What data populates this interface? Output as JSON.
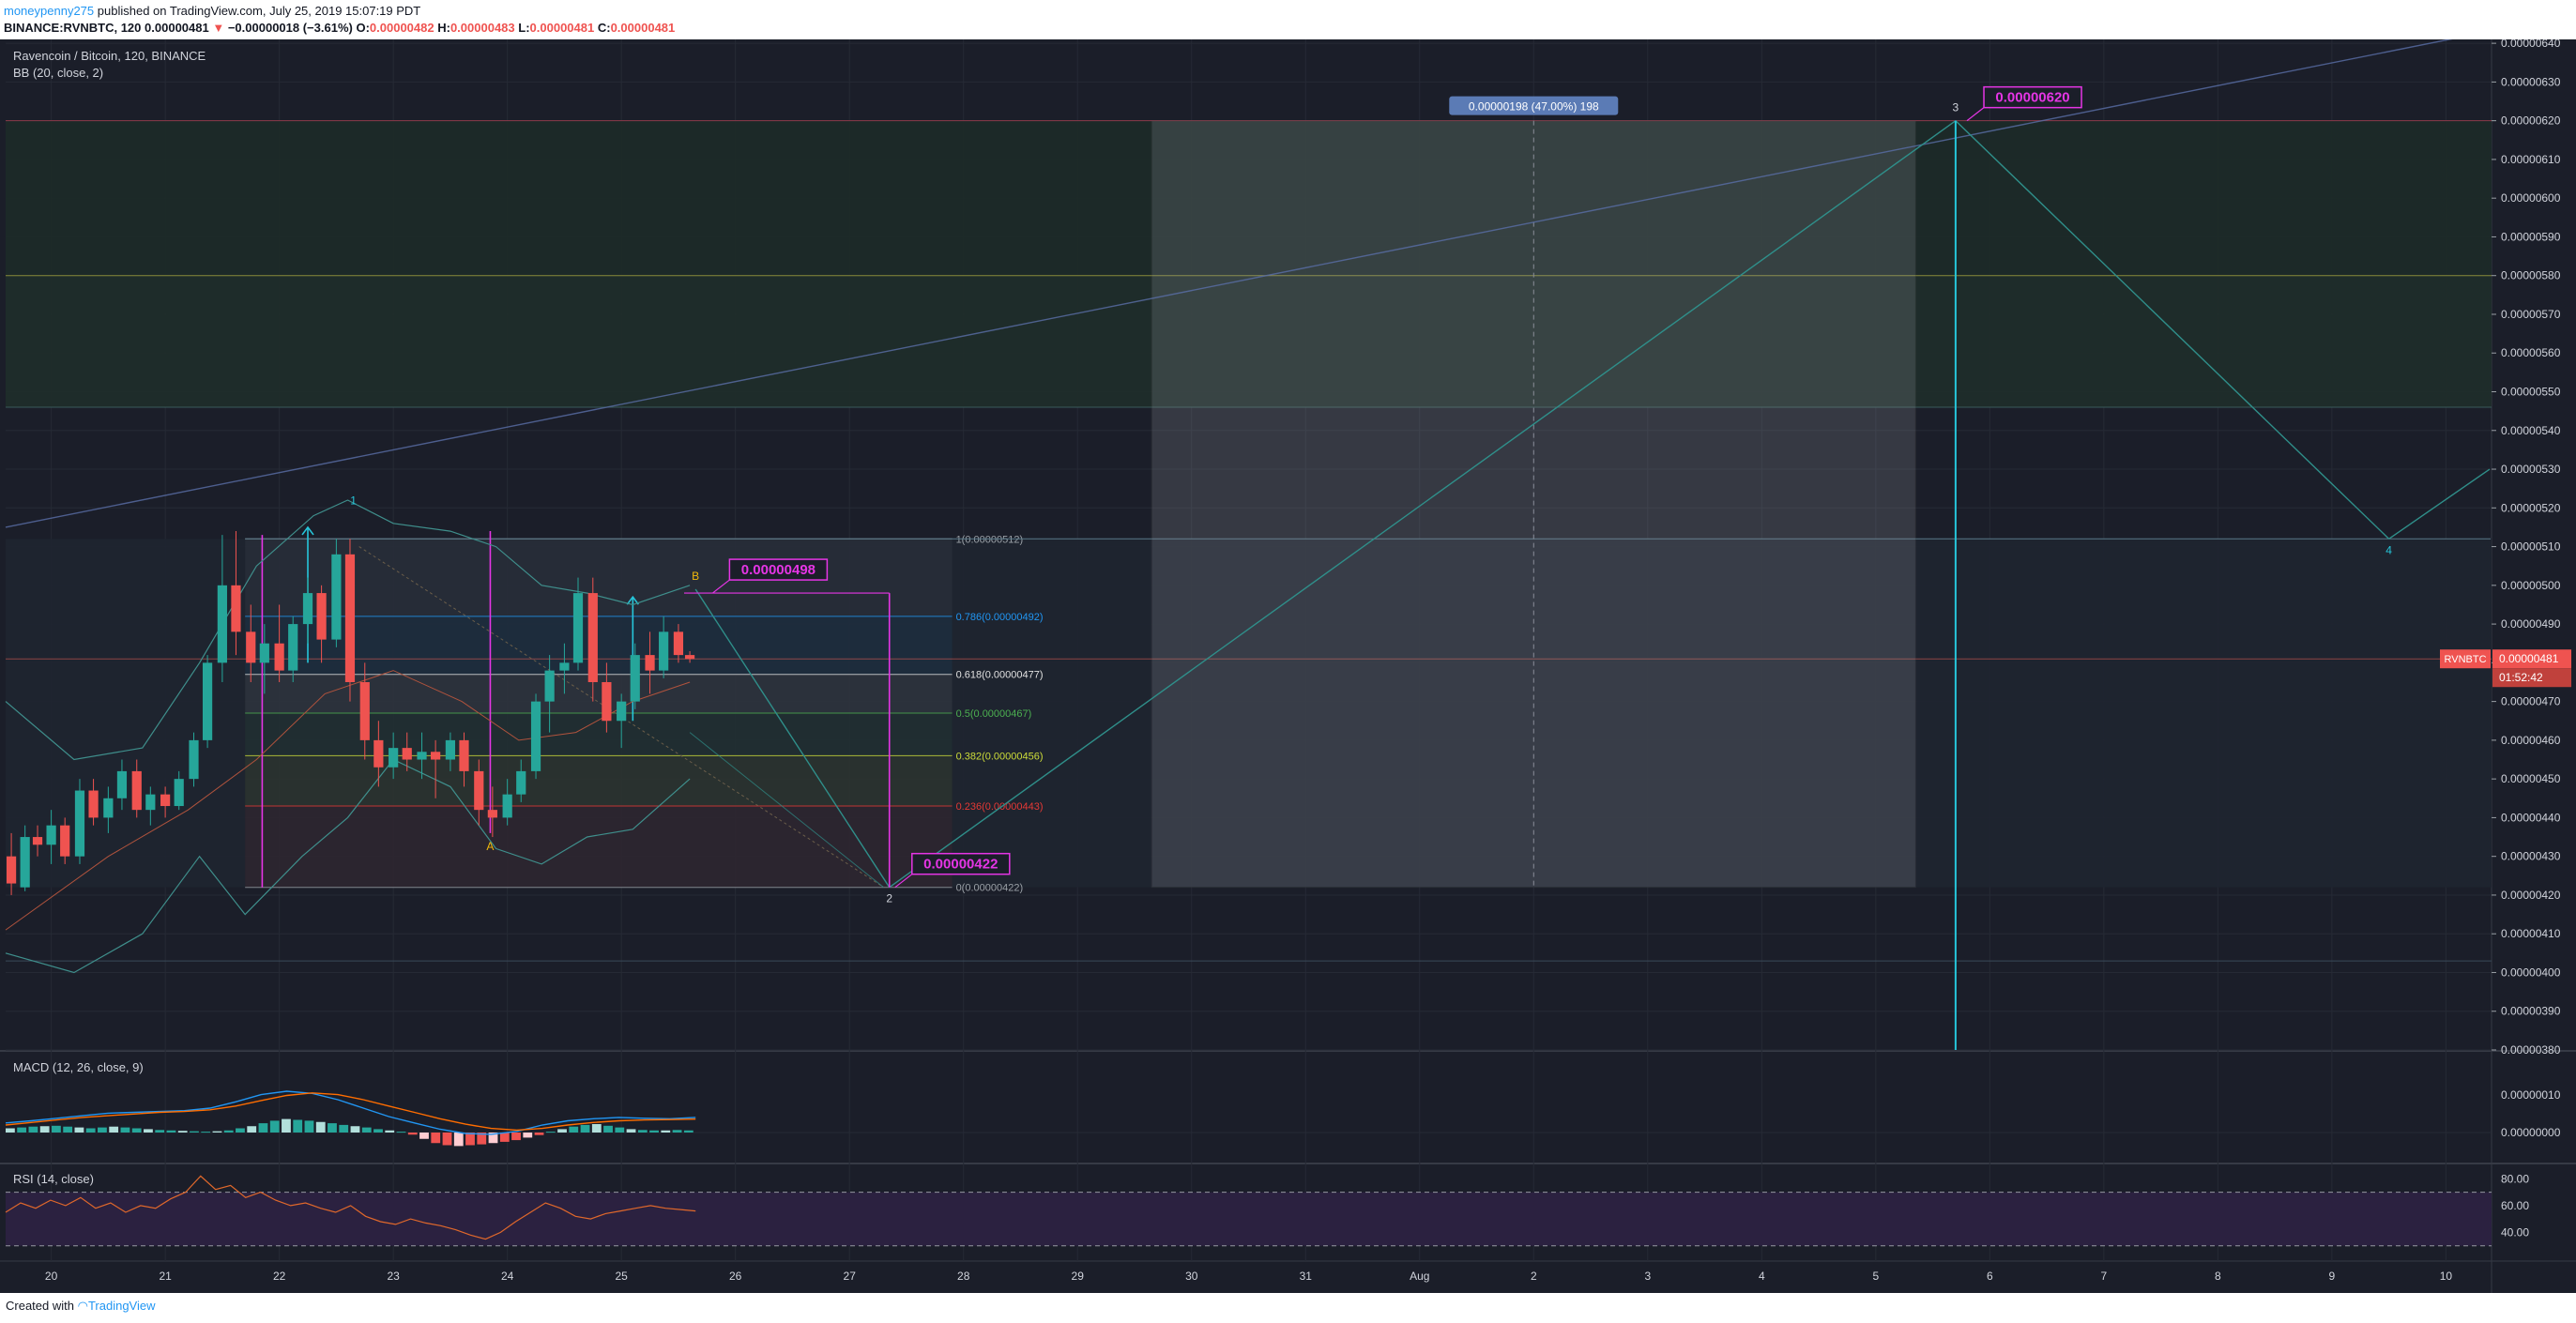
{
  "header": {
    "author": "moneypenny275",
    "published": "published on TradingView.com, July 25, 2019 15:07:19 PDT",
    "symbol_line": "BINANCE:RVNBTC, 120",
    "last": "0.00000481",
    "change_arrow": "▼",
    "change": "−0.00000018 (−3.61%)",
    "o_label": "O:",
    "o_value": "0.00000482",
    "h_label": "H:",
    "h_value": "0.00000483",
    "l_label": "L:",
    "l_value": "0.00000481",
    "c_label": "C:",
    "c_value": "0.00000481"
  },
  "footer": {
    "created_with": "Created with",
    "brand": "TradingView"
  },
  "colors": {
    "background": "#1b1e29",
    "up": "#26a69a",
    "down": "#ef5350",
    "bb": "#3f8f8c",
    "magenta": "#e535e5",
    "price_tag": "#ef5350"
  },
  "chart_data": [
    {
      "type": "line",
      "title": "Ravencoin / Bitcoin, 120, BINANCE",
      "indicator_label": "BB (20, close, 2)",
      "x_ticks": [
        "20",
        "21",
        "22",
        "23",
        "24",
        "25",
        "26",
        "27",
        "28",
        "29",
        "30",
        "31",
        "Aug",
        "2",
        "3",
        "4",
        "5",
        "6",
        "7",
        "8",
        "9",
        "10"
      ],
      "y_ticks": [
        "0.00000380",
        "0.00000390",
        "0.00000400",
        "0.00000410",
        "0.00000420",
        "0.00000430",
        "0.00000440",
        "0.00000450",
        "0.00000460",
        "0.00000470",
        "0.00000480",
        "0.00000490",
        "0.00000500",
        "0.00000510",
        "0.00000520",
        "0.00000530",
        "0.00000540",
        "0.00000550",
        "0.00000560",
        "0.00000570",
        "0.00000580",
        "0.00000590",
        "0.00000600",
        "0.00000610",
        "0.00000620",
        "0.00000630",
        "0.00000640"
      ],
      "ylim": [
        3.8e-06,
        6.41e-06
      ],
      "xlim": [
        19.6,
        41.4
      ],
      "candles": [
        {
          "t": 19.65,
          "o": 4.3,
          "h": 4.36,
          "l": 4.2,
          "c": 4.23
        },
        {
          "t": 19.77,
          "o": 4.22,
          "h": 4.38,
          "l": 4.21,
          "c": 4.35
        },
        {
          "t": 19.88,
          "o": 4.35,
          "h": 4.38,
          "l": 4.3,
          "c": 4.33
        },
        {
          "t": 20.0,
          "o": 4.33,
          "h": 4.42,
          "l": 4.28,
          "c": 4.38
        },
        {
          "t": 20.12,
          "o": 4.38,
          "h": 4.4,
          "l": 4.28,
          "c": 4.3
        },
        {
          "t": 20.25,
          "o": 4.3,
          "h": 4.5,
          "l": 4.28,
          "c": 4.47
        },
        {
          "t": 20.37,
          "o": 4.47,
          "h": 4.5,
          "l": 4.38,
          "c": 4.4
        },
        {
          "t": 20.5,
          "o": 4.4,
          "h": 4.48,
          "l": 4.36,
          "c": 4.45
        },
        {
          "t": 20.62,
          "o": 4.45,
          "h": 4.55,
          "l": 4.42,
          "c": 4.52
        },
        {
          "t": 20.75,
          "o": 4.52,
          "h": 4.55,
          "l": 4.4,
          "c": 4.42
        },
        {
          "t": 20.87,
          "o": 4.42,
          "h": 4.48,
          "l": 4.38,
          "c": 4.46
        },
        {
          "t": 21.0,
          "o": 4.46,
          "h": 4.48,
          "l": 4.4,
          "c": 4.43
        },
        {
          "t": 21.12,
          "o": 4.43,
          "h": 4.52,
          "l": 4.42,
          "c": 4.5
        },
        {
          "t": 21.25,
          "o": 4.5,
          "h": 4.62,
          "l": 4.48,
          "c": 4.6
        },
        {
          "t": 21.37,
          "o": 4.6,
          "h": 4.82,
          "l": 4.58,
          "c": 4.8
        },
        {
          "t": 21.5,
          "o": 4.8,
          "h": 5.13,
          "l": 4.75,
          "c": 5.0
        },
        {
          "t": 21.62,
          "o": 5.0,
          "h": 5.14,
          "l": 4.82,
          "c": 4.88
        },
        {
          "t": 21.75,
          "o": 4.88,
          "h": 4.95,
          "l": 4.75,
          "c": 4.8
        },
        {
          "t": 21.87,
          "o": 4.8,
          "h": 4.9,
          "l": 4.72,
          "c": 4.85
        },
        {
          "t": 22.0,
          "o": 4.85,
          "h": 4.95,
          "l": 4.75,
          "c": 4.78
        },
        {
          "t": 22.12,
          "o": 4.78,
          "h": 4.92,
          "l": 4.75,
          "c": 4.9
        },
        {
          "t": 22.25,
          "o": 4.9,
          "h": 5.02,
          "l": 4.85,
          "c": 4.98
        },
        {
          "t": 22.37,
          "o": 4.98,
          "h": 5.0,
          "l": 4.8,
          "c": 4.86
        },
        {
          "t": 22.5,
          "o": 4.86,
          "h": 5.12,
          "l": 4.84,
          "c": 5.08
        },
        {
          "t": 22.62,
          "o": 5.08,
          "h": 5.12,
          "l": 4.7,
          "c": 4.75
        },
        {
          "t": 22.75,
          "o": 4.75,
          "h": 4.8,
          "l": 4.55,
          "c": 4.6
        },
        {
          "t": 22.87,
          "o": 4.6,
          "h": 4.65,
          "l": 4.48,
          "c": 4.53
        },
        {
          "t": 23.0,
          "o": 4.53,
          "h": 4.62,
          "l": 4.5,
          "c": 4.58
        },
        {
          "t": 23.12,
          "o": 4.58,
          "h": 4.62,
          "l": 4.52,
          "c": 4.55
        },
        {
          "t": 23.25,
          "o": 4.55,
          "h": 4.62,
          "l": 4.5,
          "c": 4.57
        },
        {
          "t": 23.37,
          "o": 4.57,
          "h": 4.6,
          "l": 4.45,
          "c": 4.55
        },
        {
          "t": 23.5,
          "o": 4.55,
          "h": 4.62,
          "l": 4.52,
          "c": 4.6
        },
        {
          "t": 23.62,
          "o": 4.6,
          "h": 4.62,
          "l": 4.48,
          "c": 4.52
        },
        {
          "t": 23.75,
          "o": 4.52,
          "h": 4.55,
          "l": 4.38,
          "c": 4.42
        },
        {
          "t": 23.87,
          "o": 4.42,
          "h": 4.48,
          "l": 4.35,
          "c": 4.4
        },
        {
          "t": 24.0,
          "o": 4.4,
          "h": 4.5,
          "l": 4.38,
          "c": 4.46
        },
        {
          "t": 24.12,
          "o": 4.46,
          "h": 4.55,
          "l": 4.44,
          "c": 4.52
        },
        {
          "t": 24.25,
          "o": 4.52,
          "h": 4.72,
          "l": 4.5,
          "c": 4.7
        },
        {
          "t": 24.37,
          "o": 4.7,
          "h": 4.82,
          "l": 4.62,
          "c": 4.78
        },
        {
          "t": 24.5,
          "o": 4.78,
          "h": 4.85,
          "l": 4.72,
          "c": 4.8
        },
        {
          "t": 24.62,
          "o": 4.8,
          "h": 5.02,
          "l": 4.78,
          "c": 4.98
        },
        {
          "t": 24.75,
          "o": 4.98,
          "h": 5.02,
          "l": 4.7,
          "c": 4.75
        },
        {
          "t": 24.87,
          "o": 4.75,
          "h": 4.8,
          "l": 4.62,
          "c": 4.65
        },
        {
          "t": 25.0,
          "o": 4.65,
          "h": 4.72,
          "l": 4.58,
          "c": 4.7
        },
        {
          "t": 25.12,
          "o": 4.7,
          "h": 4.85,
          "l": 4.68,
          "c": 4.82
        },
        {
          "t": 25.25,
          "o": 4.82,
          "h": 4.88,
          "l": 4.72,
          "c": 4.78
        },
        {
          "t": 25.37,
          "o": 4.78,
          "h": 4.92,
          "l": 4.76,
          "c": 4.88
        },
        {
          "t": 25.5,
          "o": 4.88,
          "h": 4.9,
          "l": 4.8,
          "c": 4.82
        },
        {
          "t": 25.6,
          "o": 4.82,
          "h": 4.83,
          "l": 4.8,
          "c": 4.81
        }
      ],
      "bollinger_upper": [
        {
          "t": 19.6,
          "v": 4.7
        },
        {
          "t": 20.2,
          "v": 4.55
        },
        {
          "t": 20.8,
          "v": 4.58
        },
        {
          "t": 21.3,
          "v": 4.8
        },
        {
          "t": 21.8,
          "v": 5.05
        },
        {
          "t": 22.3,
          "v": 5.18
        },
        {
          "t": 22.6,
          "v": 5.22
        },
        {
          "t": 23.0,
          "v": 5.16
        },
        {
          "t": 23.5,
          "v": 5.14
        },
        {
          "t": 23.9,
          "v": 5.1
        },
        {
          "t": 24.3,
          "v": 5.0
        },
        {
          "t": 24.7,
          "v": 4.98
        },
        {
          "t": 25.1,
          "v": 4.95
        },
        {
          "t": 25.6,
          "v": 5.0
        }
      ],
      "bollinger_basis": [
        {
          "t": 19.6,
          "v": 4.11
        },
        {
          "t": 20.5,
          "v": 4.3
        },
        {
          "t": 21.2,
          "v": 4.42
        },
        {
          "t": 21.8,
          "v": 4.55
        },
        {
          "t": 22.4,
          "v": 4.72
        },
        {
          "t": 23.0,
          "v": 4.78
        },
        {
          "t": 23.6,
          "v": 4.7
        },
        {
          "t": 24.1,
          "v": 4.6
        },
        {
          "t": 24.6,
          "v": 4.62
        },
        {
          "t": 25.1,
          "v": 4.7
        },
        {
          "t": 25.6,
          "v": 4.75
        }
      ],
      "bollinger_lower": [
        {
          "t": 19.6,
          "v": 4.05
        },
        {
          "t": 20.2,
          "v": 4.0
        },
        {
          "t": 20.8,
          "v": 4.1
        },
        {
          "t": 21.3,
          "v": 4.3
        },
        {
          "t": 21.7,
          "v": 4.15
        },
        {
          "t": 22.2,
          "v": 4.3
        },
        {
          "t": 22.6,
          "v": 4.4
        },
        {
          "t": 23.0,
          "v": 4.55
        },
        {
          "t": 23.5,
          "v": 4.48
        },
        {
          "t": 23.9,
          "v": 4.32
        },
        {
          "t": 24.3,
          "v": 4.28
        },
        {
          "t": 24.7,
          "v": 4.35
        },
        {
          "t": 25.1,
          "v": 4.37
        },
        {
          "t": 25.6,
          "v": 4.5
        }
      ],
      "fibonacci": [
        {
          "label": "1(0.00000512)",
          "level": 5.12,
          "color": "#9aa0a6"
        },
        {
          "label": "0.786(0.00000492)",
          "level": 4.92,
          "color": "#2196f3"
        },
        {
          "label": "0.618(0.00000477)",
          "level": 4.77,
          "color": "#e0e0e0"
        },
        {
          "label": "0.5(0.00000467)",
          "level": 4.67,
          "color": "#4caf50"
        },
        {
          "label": "0.382(0.00000456)",
          "level": 4.56,
          "color": "#cddc39"
        },
        {
          "label": "0.236(0.00000443)",
          "level": 4.43,
          "color": "#e53935"
        },
        {
          "label": "0(0.00000422)",
          "level": 4.22,
          "color": "#9aa0a6"
        }
      ],
      "pattern_points": [
        {
          "label": "1",
          "t": 22.65,
          "v": 5.17
        },
        {
          "label": "A",
          "t": 23.85,
          "v": 4.36
        },
        {
          "label": "B",
          "t": 25.65,
          "v": 4.99
        },
        {
          "label": "2",
          "t": 27.35,
          "v": 4.22
        },
        {
          "label": "3",
          "t": 36.7,
          "v": 6.2
        },
        {
          "label": "4",
          "t": 40.5,
          "v": 5.12
        }
      ],
      "callouts": [
        {
          "text": "0.00000498",
          "t": 25.8,
          "v": 4.98
        },
        {
          "text": "0.00000422",
          "t": 27.4,
          "v": 4.22
        },
        {
          "text": "0.00000620",
          "t": 36.8,
          "v": 6.2
        }
      ],
      "range_box": {
        "label": "0.00000198 (47.00%) 198",
        "t1": 29.65,
        "t2": 36.35,
        "v1": 4.22,
        "v2": 6.2
      },
      "last_price_label": "RVNBTC",
      "last_price": "0.00000481",
      "countdown": "01:52:42"
    },
    {
      "type": "bar",
      "title": "MACD (12, 26, close, 9)",
      "y_ticks": [
        "0.00000010",
        "0.00000000"
      ],
      "histogram": [
        0.1,
        0.12,
        0.14,
        0.15,
        0.16,
        0.14,
        0.12,
        0.1,
        0.12,
        0.14,
        0.12,
        0.1,
        0.08,
        0.06,
        0.05,
        0.04,
        0.03,
        0.02,
        0.03,
        0.05,
        0.1,
        0.15,
        0.22,
        0.28,
        0.32,
        0.3,
        0.28,
        0.25,
        0.22,
        0.18,
        0.15,
        0.12,
        0.08,
        0.05,
        0.02,
        -0.05,
        -0.15,
        -0.25,
        -0.3,
        -0.32,
        -0.3,
        -0.28,
        -0.25,
        -0.22,
        -0.18,
        -0.12,
        -0.06,
        0.02,
        0.08,
        0.14,
        0.18,
        0.2,
        0.16,
        0.12,
        0.08,
        0.06,
        0.05,
        0.05,
        0.06,
        0.05
      ],
      "macd_line": [
        0.05,
        0.1,
        0.16,
        0.22,
        0.28,
        0.3,
        0.32,
        0.34,
        0.4,
        0.55,
        0.72,
        0.8,
        0.75,
        0.6,
        0.4,
        0.2,
        0.05,
        -0.1,
        -0.2,
        -0.22,
        -0.15,
        0.0,
        0.1,
        0.15,
        0.18,
        0.16,
        0.15,
        0.18
      ],
      "signal_line": [
        0.0,
        0.06,
        0.12,
        0.18,
        0.22,
        0.26,
        0.3,
        0.32,
        0.36,
        0.45,
        0.58,
        0.7,
        0.76,
        0.72,
        0.6,
        0.45,
        0.3,
        0.15,
        0.02,
        -0.08,
        -0.12,
        -0.08,
        0.0,
        0.06,
        0.1,
        0.12,
        0.13,
        0.14
      ]
    },
    {
      "type": "line",
      "title": "RSI (14, close)",
      "y_ticks": [
        "80.00",
        "60.00",
        "40.00"
      ],
      "ylim": [
        20,
        90
      ],
      "bands": [
        70,
        30
      ],
      "values": [
        55,
        62,
        58,
        64,
        60,
        66,
        58,
        62,
        55,
        60,
        58,
        65,
        70,
        82,
        72,
        75,
        66,
        70,
        64,
        60,
        62,
        58,
        55,
        60,
        52,
        48,
        46,
        50,
        47,
        45,
        42,
        38,
        35,
        40,
        48,
        55,
        62,
        58,
        52,
        50,
        54,
        56,
        58,
        60,
        58,
        57,
        56
      ]
    }
  ]
}
